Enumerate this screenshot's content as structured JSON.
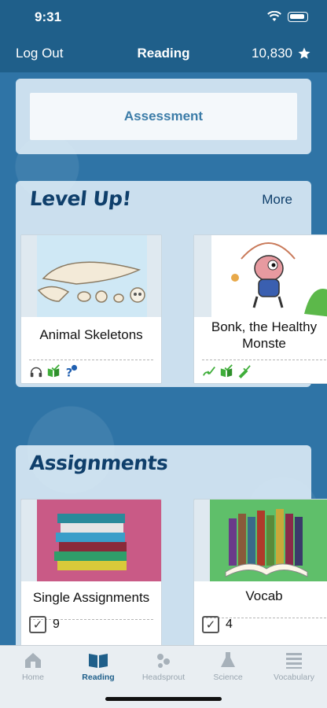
{
  "status": {
    "time": "9:31"
  },
  "nav": {
    "left": "Log Out",
    "title": "Reading",
    "stars": "10,830"
  },
  "assessment": {
    "label": "Assessment"
  },
  "levelup": {
    "title": "Level Up!",
    "more": "More",
    "cards": [
      {
        "title": "Animal Skeletons",
        "icons": [
          "headphones-icon",
          "book-check-icon",
          "quiz-icon"
        ]
      },
      {
        "title": "Bonk, the Healthy Monste",
        "icons": [
          "check-icon",
          "book-check-icon",
          "pencil-check-icon"
        ]
      }
    ]
  },
  "assignments": {
    "title": "Assignments",
    "cards": [
      {
        "title": "Single Assignments",
        "count": "9"
      },
      {
        "title": "Vocab",
        "count": "4"
      }
    ]
  },
  "tabs": [
    {
      "label": "Home",
      "icon": "house-icon"
    },
    {
      "label": "Reading",
      "icon": "open-book-icon",
      "active": true
    },
    {
      "label": "Headsprout",
      "icon": "headsprout-icon"
    },
    {
      "label": "Science",
      "icon": "flask-icon"
    },
    {
      "label": "Vocabulary",
      "icon": "list-icon"
    }
  ],
  "colors": {
    "accent": "#1f5f8a",
    "title": "#0f3f6b",
    "green": "#3fae3a"
  }
}
